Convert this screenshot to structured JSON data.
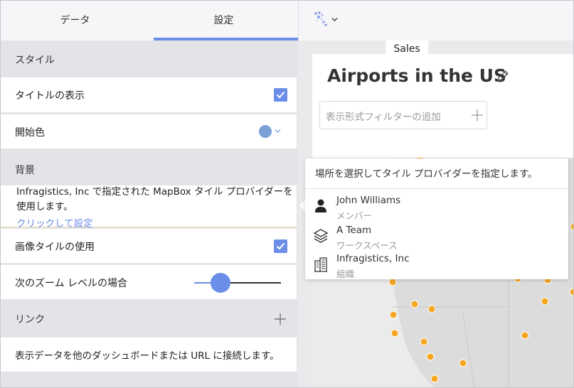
{
  "tabs": [
    {
      "label": "データ"
    },
    {
      "label": "設定"
    }
  ],
  "settings": {
    "style_heading": "スタイル",
    "show_title_label": "タイトルの表示",
    "start_color_label": "開始色",
    "start_color_value": "#7aa0d8",
    "background_heading": "背景",
    "tile_info_text": "Infragistics, Inc で指定された MapBox タイル プロバイダーを使用します。",
    "tile_info_link": "クリックして設定",
    "use_image_tiles_label": "画像タイルの使用",
    "zoom_level_label": "次のズーム レベルの場合",
    "zoom_level_fraction": 0.3,
    "link_heading": "リンク",
    "link_desc": "表示データを他のダッシュボードまたは URL に接続します。"
  },
  "dashboard": {
    "tab_label": "Sales",
    "title": "Airports in the US",
    "filter_placeholder": "表示形式フィルターの追加"
  },
  "popup": {
    "header": "場所を選択してタイル プロバイダーを指定します。",
    "items": [
      {
        "name": "John Williams",
        "sub": "メンバー",
        "icon": "person-icon"
      },
      {
        "name": "A Team",
        "sub": "ワークスペース",
        "icon": "layers-icon"
      },
      {
        "name": "Infragistics, Inc",
        "sub": "組織",
        "icon": "building-icon"
      }
    ]
  },
  "colors": {
    "accent": "#6b8ee8",
    "airport_dot": "#f5a623"
  }
}
